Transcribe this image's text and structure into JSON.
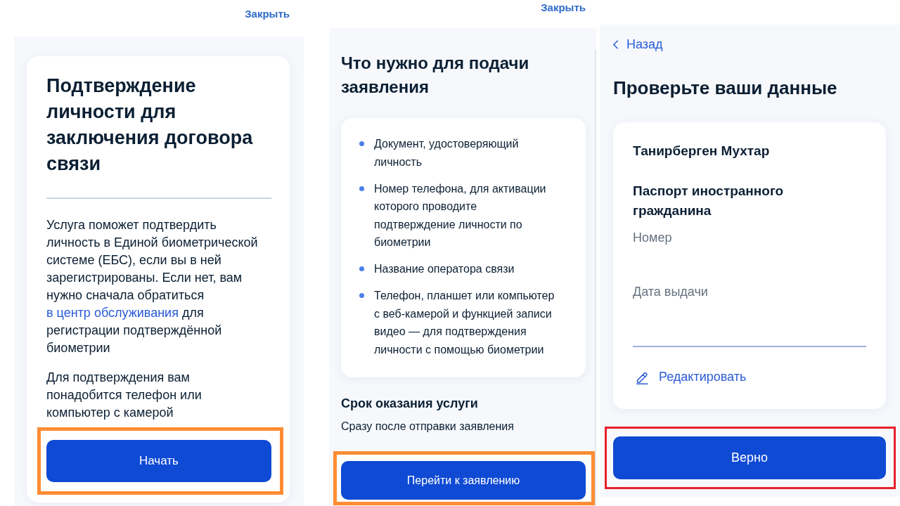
{
  "intro_screen": {
    "close_link": "Закрыть",
    "title": "Подтверждение личности для заключения договора связи",
    "description": {
      "text": "Услуга поможет подтвердить личность в Единой биометрической системе (ЕБС), если вы в ней зарегистрированы. Если нет, вам нужно сначала обратиться",
      "link": "в центр обслуживания",
      "text_after": "для регистрации подтверждённой биометрии"
    },
    "note": "Для подтверждения вам понадобится телефон или компьютер с камерой",
    "button": {
      "label": "Начать",
      "highlight": {
        "color": "#ff8c33"
      }
    }
  },
  "requirements_screen": {
    "close_link": "Закрыть",
    "title": "Что нужно для подачи заявления",
    "items": [
      "Документ, удостоверяющий личность",
      "Номер телефона, для активации которого проводите подтверждение личности по биометрии",
      "Название оператора связи",
      "Телефон, планшет или компьютер с веб-камерой и функцией записи видео — для подтверждения личности с помощью биометрии"
    ],
    "term": {
      "heading": "Срок оказания услуги",
      "text": "Сразу после отправки заявления"
    },
    "button": {
      "label": "Перейти к заявлению",
      "highlight": {
        "color": "#ff8c33"
      }
    }
  },
  "review_screen": {
    "back_link": "Назад",
    "title": "Проверьте ваши данные",
    "card": {
      "name": "Танирберген Мухтар",
      "document": "Паспорт иностранного гражданина",
      "fields": [
        {
          "label": "Номер"
        },
        {
          "label": "Дата выдачи"
        }
      ],
      "edit_link": "Редактировать"
    },
    "button": {
      "label": "Верно",
      "highlight": {
        "color": "#e8202a"
      }
    }
  }
}
